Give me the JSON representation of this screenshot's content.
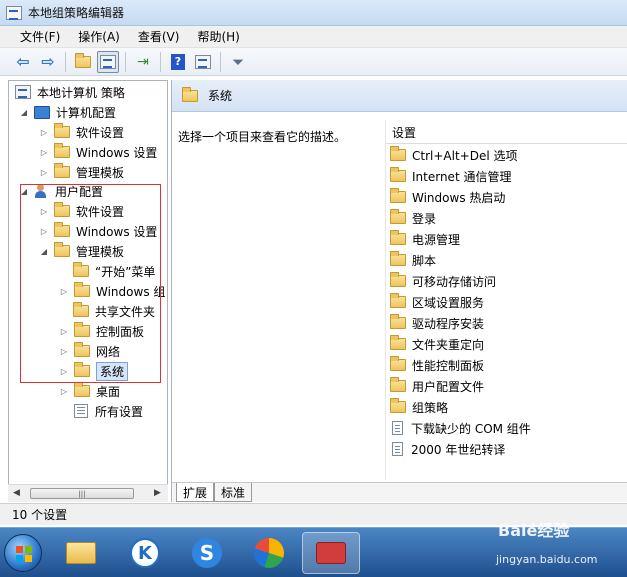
{
  "window": {
    "title": "本地组策略编辑器"
  },
  "menu": [
    {
      "label": "文件(F)"
    },
    {
      "label": "操作(A)"
    },
    {
      "label": "查看(V)"
    },
    {
      "label": "帮助(H)"
    }
  ],
  "toolbar": {
    "icons": [
      "back-arrow-icon",
      "forward-arrow-icon",
      "up-folder-icon",
      "show-hide-tree-icon",
      "export-list-icon",
      "help-icon",
      "properties-icon",
      "filter-icon"
    ]
  },
  "tree": {
    "root": "本地计算机 策略",
    "computer": "计算机配置",
    "c_software": "软件设置",
    "c_windows": "Windows 设置",
    "c_admin": "管理模板",
    "user": "用户配置",
    "u_software": "软件设置",
    "u_windows": "Windows 设置",
    "u_admin": "管理模板",
    "start_menu": "“开始”菜单",
    "win_components": "Windows 组",
    "shared_folders": "共享文件夹",
    "control_panel": "控制面板",
    "network": "网络",
    "system": "系统",
    "desktop": "桌面",
    "all_settings": "所有设置"
  },
  "right": {
    "header": "系统",
    "description": "选择一个项目来查看它的描述。",
    "column": "设置",
    "items": [
      {
        "label": "Ctrl+Alt+Del 选项",
        "kind": "folder"
      },
      {
        "label": "Internet 通信管理",
        "kind": "folder"
      },
      {
        "label": "Windows 热启动",
        "kind": "folder"
      },
      {
        "label": "登录",
        "kind": "folder"
      },
      {
        "label": "电源管理",
        "kind": "folder"
      },
      {
        "label": "脚本",
        "kind": "folder"
      },
      {
        "label": "可移动存储访问",
        "kind": "folder"
      },
      {
        "label": "区域设置服务",
        "kind": "folder"
      },
      {
        "label": "驱动程序安装",
        "kind": "folder"
      },
      {
        "label": "文件夹重定向",
        "kind": "folder"
      },
      {
        "label": "性能控制面板",
        "kind": "folder"
      },
      {
        "label": "用户配置文件",
        "kind": "folder"
      },
      {
        "label": "组策略",
        "kind": "folder"
      },
      {
        "label": "下载缺少的 COM 组件",
        "kind": "setting"
      },
      {
        "label": "2000 年世纪转译",
        "kind": "setting"
      }
    ],
    "tabs": [
      "扩展",
      "标准"
    ]
  },
  "status": {
    "text": "10 个设置"
  },
  "watermark": {
    "brand": "Baié经验",
    "url": "jingyan.baidu.com"
  },
  "colors": {
    "highlight_box": "#e03131",
    "selection": "#d5e6fb"
  }
}
